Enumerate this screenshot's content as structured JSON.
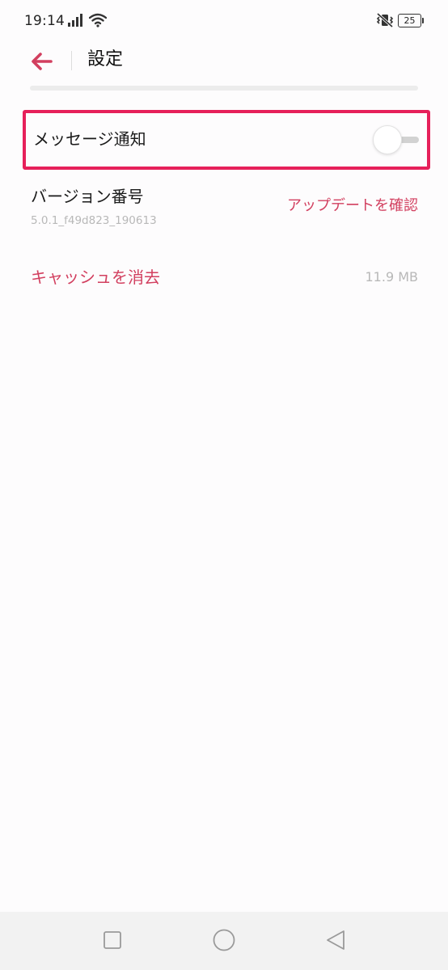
{
  "status_bar": {
    "time": "19:14",
    "battery_level": "25",
    "icons": [
      "signal-icon",
      "wifi-icon",
      "vibrate-off-icon",
      "battery-icon"
    ]
  },
  "header": {
    "back_icon": "arrow-left-icon",
    "title": "設定"
  },
  "settings": {
    "message_notification": {
      "label": "メッセージ通知",
      "toggle_on": false
    },
    "version": {
      "label": "バージョン番号",
      "value": "5.0.1_f49d823_190613",
      "action": "アップデートを確認"
    },
    "cache": {
      "action": "キャッシュを消去",
      "size": "11.9 MB"
    }
  },
  "nav_bar": {
    "icons": [
      "recents-square-icon",
      "home-circle-icon",
      "back-triangle-icon"
    ]
  },
  "colors": {
    "accent": "#d23f5f",
    "highlight_border": "#e6205a",
    "background": "#fdfcfd",
    "muted_text": "#b8b8b8",
    "nav_background": "#f2f2f2"
  }
}
